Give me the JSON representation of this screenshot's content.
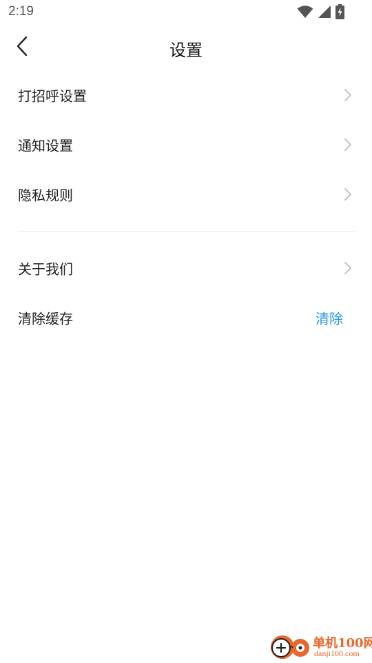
{
  "status_bar": {
    "time": "2:19",
    "icons": [
      "wifi-icon",
      "cell-signal-icon",
      "battery-charging-icon"
    ]
  },
  "header": {
    "title": "设置",
    "back_icon": "chevron-left-icon"
  },
  "settings": {
    "group1": [
      {
        "label": "打招呼设置",
        "icon": "chevron-right-icon"
      },
      {
        "label": "通知设置",
        "icon": "chevron-right-icon"
      },
      {
        "label": "隐私规则",
        "icon": "chevron-right-icon"
      }
    ],
    "group2": {
      "about": {
        "label": "关于我们",
        "icon": "chevron-right-icon"
      },
      "clear_cache": {
        "label": "清除缓存",
        "action": "清除"
      }
    }
  },
  "watermark": {
    "title": "单机100网",
    "url": "danji100.com"
  },
  "colors": {
    "accent": "#2196e8",
    "text": "#222222",
    "chevron": "#c4c4c4",
    "divider": "#ececec",
    "watermark": "#e8672a"
  }
}
